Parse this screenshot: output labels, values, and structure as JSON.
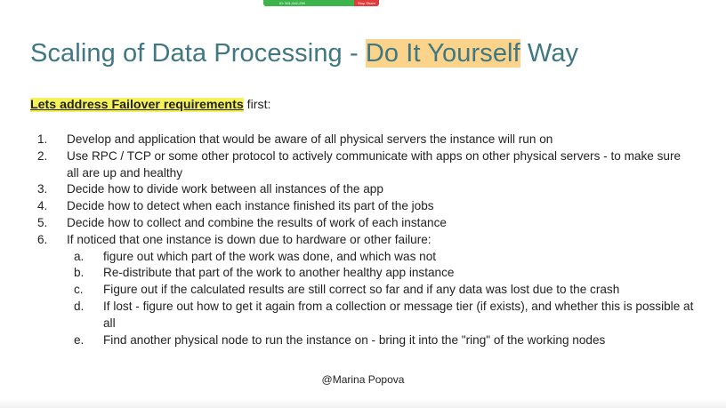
{
  "share_bar": {
    "meeting_id": "ID: 501-642-259",
    "stop_label": "Stop Share",
    "bar_color": "#3cb44b",
    "stop_color": "#e23b3b"
  },
  "slide": {
    "title_pre": "Scaling of Data Processing - ",
    "title_highlight": "Do It Yourself",
    "title_post": " Way",
    "subtitle_highlight": "Lets address Failover requirements",
    "subtitle_rest": " first:",
    "items": [
      {
        "num": "1.",
        "text": "Develop and application that would be aware of all physical servers the instance will run on"
      },
      {
        "num": "2.",
        "text": "Use RPC / TCP or some other protocol to actively communicate with apps on other physical servers - to make sure all are up and healthy"
      },
      {
        "num": "3.",
        "text": "Decide how to divide work between all instances of the app"
      },
      {
        "num": "4.",
        "text": "Decide how to detect when each instance finished its part of the jobs"
      },
      {
        "num": "5.",
        "text": "Decide how to collect and combine the results of work of each instance"
      },
      {
        "num": "6.",
        "text": "If noticed that one instance is down due to hardware or other failure:"
      }
    ],
    "subitems": [
      {
        "num": "a.",
        "text": "figure out which part of the work was done, and which was not"
      },
      {
        "num": "b.",
        "text": "Re-distribute that part of the work to another healthy app instance"
      },
      {
        "num": "c.",
        "text": "Figure out if the calculated results are still correct so far and if any data was lost due to the crash"
      },
      {
        "num": "d.",
        "text": "If lost - figure out how to get it again from a collection or message tier (if exists), and whether this is possible at all"
      },
      {
        "num": "e.",
        "text": "Find another physical node to run the instance on - bring it into the \"ring\" of the working nodes"
      }
    ],
    "footer": "@Marina Popova",
    "colors": {
      "title": "#3f7782",
      "title_highlight": "#fbd38a",
      "subtitle_highlight": "#f6f25a"
    }
  }
}
